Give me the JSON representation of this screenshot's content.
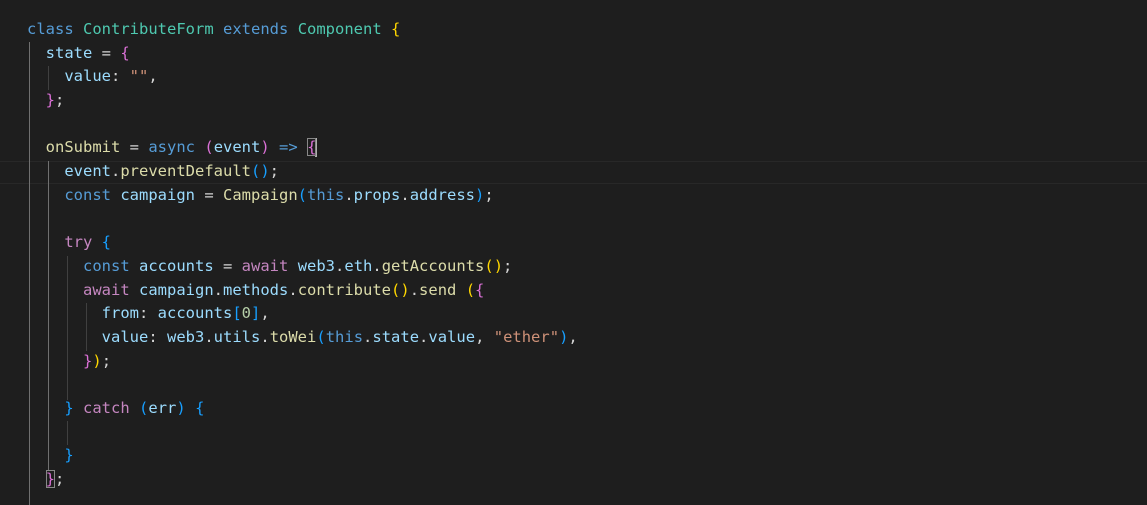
{
  "editor": {
    "language": "javascript",
    "theme": "dark",
    "lines": [
      {
        "tokens": [
          {
            "t": "class",
            "c": "kw"
          },
          {
            "t": " ",
            "c": "punc"
          },
          {
            "t": "ContributeForm",
            "c": "cls"
          },
          {
            "t": " ",
            "c": "punc"
          },
          {
            "t": "extends",
            "c": "kw"
          },
          {
            "t": " ",
            "c": "punc"
          },
          {
            "t": "Component",
            "c": "cls"
          },
          {
            "t": " ",
            "c": "punc"
          },
          {
            "t": "{",
            "c": "b1"
          }
        ]
      },
      {
        "tokens": [
          {
            "t": "  ",
            "c": "punc"
          },
          {
            "t": "state",
            "c": "var"
          },
          {
            "t": " = ",
            "c": "punc"
          },
          {
            "t": "{",
            "c": "b2"
          }
        ]
      },
      {
        "tokens": [
          {
            "t": "    ",
            "c": "punc"
          },
          {
            "t": "value",
            "c": "var"
          },
          {
            "t": ": ",
            "c": "punc"
          },
          {
            "t": "\"\"",
            "c": "str"
          },
          {
            "t": ",",
            "c": "punc"
          }
        ]
      },
      {
        "tokens": [
          {
            "t": "  ",
            "c": "punc"
          },
          {
            "t": "}",
            "c": "b2"
          },
          {
            "t": ";",
            "c": "punc"
          }
        ]
      },
      {
        "tokens": []
      },
      {
        "tokens": [
          {
            "t": "  ",
            "c": "punc"
          },
          {
            "t": "onSubmit",
            "c": "fn"
          },
          {
            "t": " = ",
            "c": "punc"
          },
          {
            "t": "async",
            "c": "kw"
          },
          {
            "t": " ",
            "c": "punc"
          },
          {
            "t": "(",
            "c": "b2"
          },
          {
            "t": "event",
            "c": "var"
          },
          {
            "t": ")",
            "c": "b2"
          },
          {
            "t": " ",
            "c": "punc"
          },
          {
            "t": "=>",
            "c": "kw"
          },
          {
            "t": " ",
            "c": "punc"
          },
          {
            "t": "{",
            "c": "b2 bm"
          },
          {
            "cursor": true
          }
        ]
      },
      {
        "tokens": [
          {
            "t": "    ",
            "c": "punc"
          },
          {
            "t": "event",
            "c": "var"
          },
          {
            "t": ".",
            "c": "punc"
          },
          {
            "t": "preventDefault",
            "c": "fn"
          },
          {
            "t": "()",
            "c": "b3"
          },
          {
            "t": ";",
            "c": "punc"
          }
        ]
      },
      {
        "tokens": [
          {
            "t": "    ",
            "c": "punc"
          },
          {
            "t": "const",
            "c": "kw"
          },
          {
            "t": " ",
            "c": "punc"
          },
          {
            "t": "campaign",
            "c": "var"
          },
          {
            "t": " = ",
            "c": "punc"
          },
          {
            "t": "Campaign",
            "c": "fn"
          },
          {
            "t": "(",
            "c": "b3"
          },
          {
            "t": "this",
            "c": "kw"
          },
          {
            "t": ".",
            "c": "punc"
          },
          {
            "t": "props",
            "c": "var"
          },
          {
            "t": ".",
            "c": "punc"
          },
          {
            "t": "address",
            "c": "var"
          },
          {
            "t": ")",
            "c": "b3"
          },
          {
            "t": ";",
            "c": "punc"
          }
        ]
      },
      {
        "tokens": []
      },
      {
        "tokens": [
          {
            "t": "    ",
            "c": "punc"
          },
          {
            "t": "try",
            "c": "ctl"
          },
          {
            "t": " ",
            "c": "punc"
          },
          {
            "t": "{",
            "c": "b3"
          }
        ]
      },
      {
        "tokens": [
          {
            "t": "      ",
            "c": "punc"
          },
          {
            "t": "const",
            "c": "kw"
          },
          {
            "t": " ",
            "c": "punc"
          },
          {
            "t": "accounts",
            "c": "var"
          },
          {
            "t": " = ",
            "c": "punc"
          },
          {
            "t": "await",
            "c": "ctl"
          },
          {
            "t": " ",
            "c": "punc"
          },
          {
            "t": "web3",
            "c": "var"
          },
          {
            "t": ".",
            "c": "punc"
          },
          {
            "t": "eth",
            "c": "var"
          },
          {
            "t": ".",
            "c": "punc"
          },
          {
            "t": "getAccounts",
            "c": "fn"
          },
          {
            "t": "()",
            "c": "b1"
          },
          {
            "t": ";",
            "c": "punc"
          }
        ]
      },
      {
        "tokens": [
          {
            "t": "      ",
            "c": "punc"
          },
          {
            "t": "await",
            "c": "ctl"
          },
          {
            "t": " ",
            "c": "punc"
          },
          {
            "t": "campaign",
            "c": "var"
          },
          {
            "t": ".",
            "c": "punc"
          },
          {
            "t": "methods",
            "c": "var"
          },
          {
            "t": ".",
            "c": "punc"
          },
          {
            "t": "contribute",
            "c": "fn"
          },
          {
            "t": "()",
            "c": "b1"
          },
          {
            "t": ".",
            "c": "punc"
          },
          {
            "t": "send",
            "c": "fn"
          },
          {
            "t": " ",
            "c": "punc"
          },
          {
            "t": "(",
            "c": "b1"
          },
          {
            "t": "{",
            "c": "b2"
          }
        ]
      },
      {
        "tokens": [
          {
            "t": "        ",
            "c": "punc"
          },
          {
            "t": "from",
            "c": "var"
          },
          {
            "t": ": ",
            "c": "punc"
          },
          {
            "t": "accounts",
            "c": "var"
          },
          {
            "t": "[",
            "c": "b3"
          },
          {
            "t": "0",
            "c": "num"
          },
          {
            "t": "]",
            "c": "b3"
          },
          {
            "t": ",",
            "c": "punc"
          }
        ]
      },
      {
        "tokens": [
          {
            "t": "        ",
            "c": "punc"
          },
          {
            "t": "value",
            "c": "var"
          },
          {
            "t": ": ",
            "c": "punc"
          },
          {
            "t": "web3",
            "c": "var"
          },
          {
            "t": ".",
            "c": "punc"
          },
          {
            "t": "utils",
            "c": "var"
          },
          {
            "t": ".",
            "c": "punc"
          },
          {
            "t": "toWei",
            "c": "fn"
          },
          {
            "t": "(",
            "c": "b3"
          },
          {
            "t": "this",
            "c": "kw"
          },
          {
            "t": ".",
            "c": "punc"
          },
          {
            "t": "state",
            "c": "var"
          },
          {
            "t": ".",
            "c": "punc"
          },
          {
            "t": "value",
            "c": "var"
          },
          {
            "t": ", ",
            "c": "punc"
          },
          {
            "t": "\"ether\"",
            "c": "str"
          },
          {
            "t": ")",
            "c": "b3"
          },
          {
            "t": ",",
            "c": "punc"
          }
        ]
      },
      {
        "tokens": [
          {
            "t": "      ",
            "c": "punc"
          },
          {
            "t": "}",
            "c": "b2"
          },
          {
            "t": ")",
            "c": "b1"
          },
          {
            "t": ";",
            "c": "punc"
          }
        ]
      },
      {
        "tokens": []
      },
      {
        "tokens": [
          {
            "t": "    ",
            "c": "punc"
          },
          {
            "t": "}",
            "c": "b3"
          },
          {
            "t": " ",
            "c": "punc"
          },
          {
            "t": "catch",
            "c": "ctl"
          },
          {
            "t": " ",
            "c": "punc"
          },
          {
            "t": "(",
            "c": "b3"
          },
          {
            "t": "err",
            "c": "var"
          },
          {
            "t": ")",
            "c": "b3"
          },
          {
            "t": " ",
            "c": "punc"
          },
          {
            "t": "{",
            "c": "b3"
          }
        ]
      },
      {
        "tokens": []
      },
      {
        "tokens": [
          {
            "t": "    ",
            "c": "punc"
          },
          {
            "t": "}",
            "c": "b3"
          }
        ]
      },
      {
        "tokens": [
          {
            "t": "  ",
            "c": "punc"
          },
          {
            "t": "}",
            "c": "b2 bm"
          },
          {
            "t": ";",
            "c": "punc"
          }
        ]
      }
    ]
  }
}
